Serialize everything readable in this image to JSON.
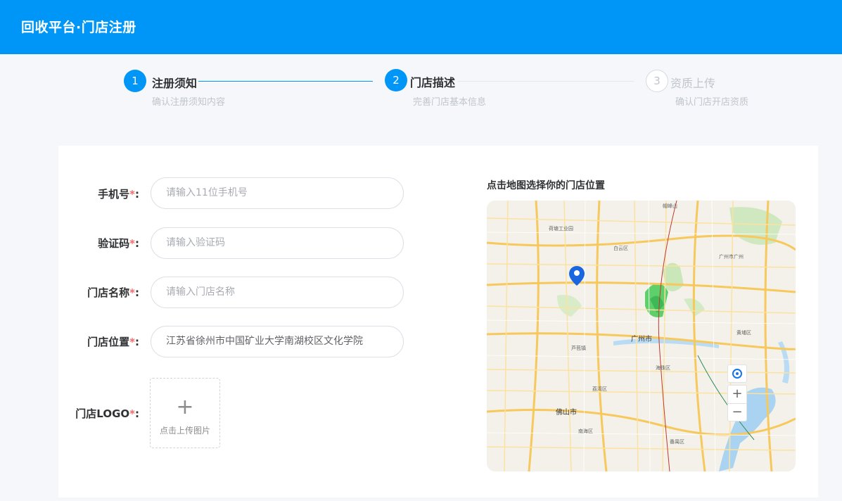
{
  "header": {
    "title": "回收平台·门店注册"
  },
  "steps": [
    {
      "number": "1",
      "title": "注册须知",
      "desc": "确认注册须知内容",
      "state": "done"
    },
    {
      "number": "2",
      "title": "门店描述",
      "desc": "完善门店基本信息",
      "state": "active"
    },
    {
      "number": "3",
      "title": "资质上传",
      "desc": "确认门店开店资质",
      "state": "todo"
    }
  ],
  "form": {
    "required_mark": "*",
    "phone": {
      "label": "手机号",
      "placeholder": "请输入11位手机号",
      "value": ""
    },
    "code": {
      "label": "验证码",
      "placeholder": "请输入验证码",
      "value": ""
    },
    "store_name": {
      "label": "门店名称",
      "placeholder": "请输入门店名称",
      "value": ""
    },
    "store_location": {
      "label": "门店位置",
      "placeholder": "",
      "value": "江苏省徐州市中国矿业大学南湖校区文化学院"
    },
    "logo": {
      "label": "门店LOGO",
      "upload_icon": "plus-icon",
      "upload_text": "点击上传图片"
    }
  },
  "map": {
    "title": "点击地图选择你的门店位置",
    "city_label": "广州市",
    "secondary_label": "佛山市",
    "controls": {
      "locate_icon": "locate-icon",
      "zoom_in": "+",
      "zoom_out": "−"
    }
  },
  "colors": {
    "primary": "#0096f7",
    "required": "#f56c6c",
    "muted": "#c0c4cc"
  }
}
